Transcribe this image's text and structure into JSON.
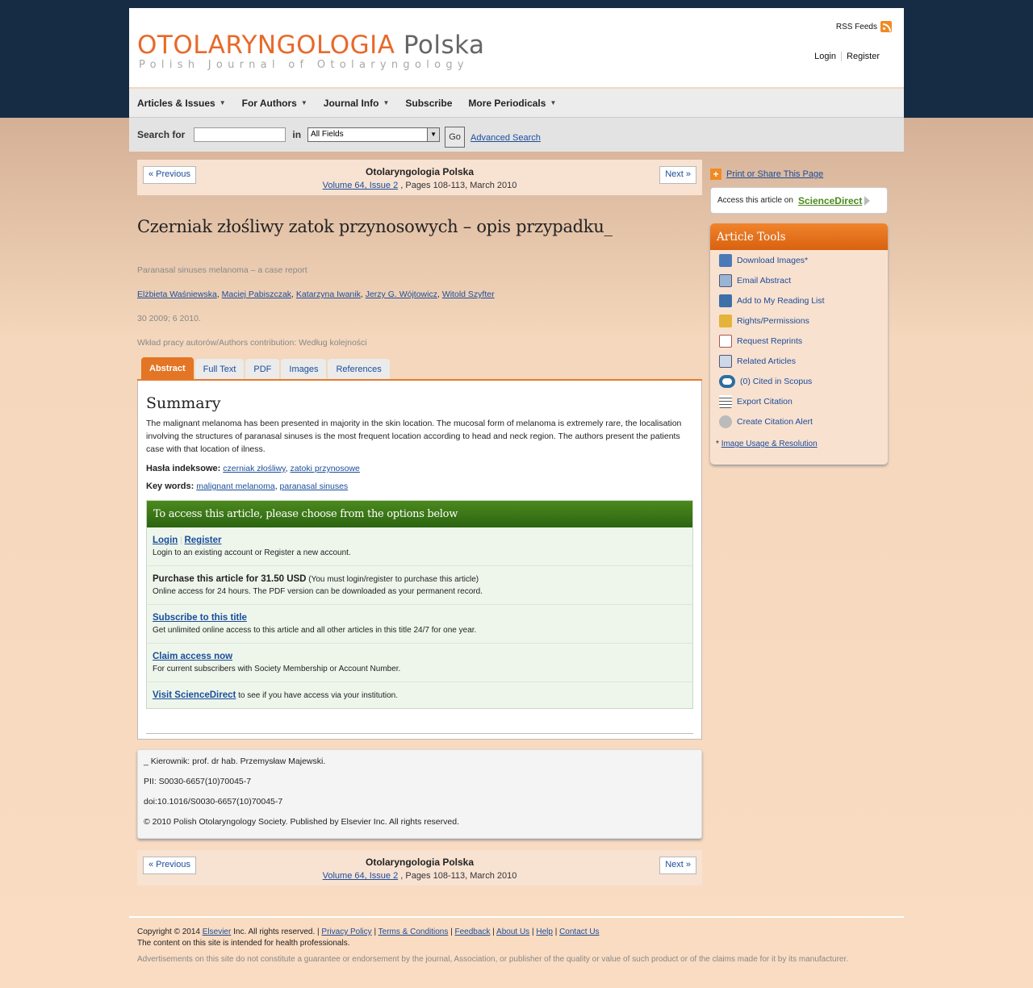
{
  "header": {
    "logo_main": "OTOLARYNGOLOGIA",
    "logo_polska": "Polska",
    "logo_sub": "Polish Journal of Otolaryngology",
    "rss": "RSS Feeds",
    "login": "Login",
    "register": "Register"
  },
  "nav": {
    "items": [
      "Articles & Issues",
      "For Authors",
      "Journal Info",
      "Subscribe",
      "More Periodicals"
    ]
  },
  "search": {
    "label": "Search for",
    "in": "in",
    "field": "All Fields",
    "go": "Go",
    "advanced": "Advanced Search"
  },
  "pager": {
    "prev": "« Previous",
    "next": "Next »",
    "journal": "Otolaryngologia Polska",
    "volume": "Volume 64, Issue 2",
    "pages": ", Pages 108-113, March 2010"
  },
  "article": {
    "title": "Czerniak złośliwy zatok przynosowych – opis przypadku_",
    "subtitle": "Paranasal sinuses melanoma – a case report",
    "authors": [
      "Elżbieta Waśniewska",
      "Maciej Pabiszczak",
      "Katarzyna Iwanik",
      "Jerzy G. Wójtowicz",
      "Witold Szyfter"
    ],
    "date": "30 2009; 6 2010.",
    "contribution": "Wkład pracy autorów/Authors contribution: Według kolejności"
  },
  "tabs": [
    "Abstract",
    "Full Text",
    "PDF",
    "Images",
    "References"
  ],
  "abstract": {
    "heading": "Summary",
    "text": "The malignant melanoma has been presented in majority in the skin location. The mucosal form of melanoma is extremely rare, the localisation involving the structures of paranasal sinuses is the most frequent location according to head and neck region. The authors present the patients case with that location of ilness.",
    "hasla_label": "Hasła indeksowe:",
    "hasla": [
      "czerniak złośliwy",
      "zatoki przynosowe"
    ],
    "kw_label": "Key words:",
    "kw": [
      "malignant melanoma",
      "paranasal sinuses"
    ]
  },
  "access": {
    "heading": "To access this article, please choose from the options below",
    "login": "Login",
    "register": "Register",
    "login_desc": "Login to an existing account or Register a new account.",
    "purchase": "Purchase this article for 31.50 USD",
    "purchase_note": "(You must login/register to purchase this article)",
    "purchase_desc": "Online access for 24 hours. The PDF version can be downloaded as your permanent record.",
    "subscribe": "Subscribe to this title",
    "subscribe_desc": "Get unlimited online access to this article and all other articles in this title 24/7 for one year.",
    "claim": "Claim access now",
    "claim_desc": "For current subscribers with Society Membership or Account Number.",
    "visit": "Visit ScienceDirect",
    "visit_desc": "to see if you have access via your institution."
  },
  "info": {
    "line1": "_ Kierownik: prof. dr hab. Przemysław Majewski.",
    "pii": "PII: S0030-6657(10)70045-7",
    "doi": "doi:10.1016/S0030-6657(10)70045-7",
    "copyright": "© 2010 Polish Otolaryngology Society. Published by Elsevier Inc. All rights reserved."
  },
  "side": {
    "print": "Print or Share This Page",
    "access_on": "Access this article on",
    "sciencedirect": "ScienceDirect",
    "tools_heading": "Article Tools",
    "tools": [
      "Download Images*",
      "Email Abstract",
      "Add to My Reading List",
      "Rights/Permissions",
      "Request Reprints",
      "Related Articles",
      "(0) Cited in Scopus",
      "Export Citation",
      "Create Citation Alert"
    ],
    "note_star": "*",
    "note_link": "Image Usage & Resolution"
  },
  "footer": {
    "copy_pre": "Copyright © 2014",
    "elsevier": "Elsevier",
    "copy_post": "Inc. All rights reserved.",
    "links": [
      "Privacy Policy",
      "Terms & Conditions",
      "Feedback",
      "About Us",
      "Help",
      "Contact Us"
    ],
    "line2": "The content on this site is intended for health professionals.",
    "line3": "Advertisements on this site do not constitute a guarantee or endorsement by the journal, Association, or publisher of the quality or value of such product or of the claims made for it by its manufacturer."
  }
}
